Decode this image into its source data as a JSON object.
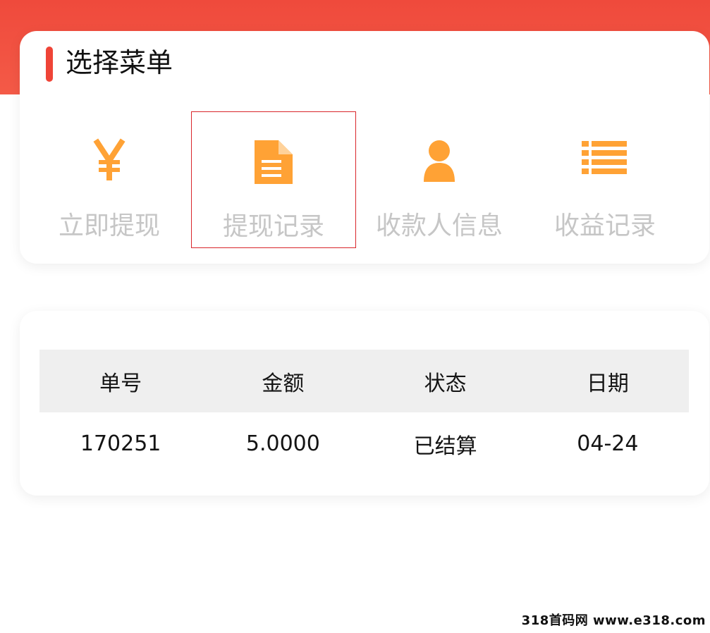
{
  "menu": {
    "title": "选择菜单",
    "items": [
      {
        "label": "立即提现",
        "icon": "yen-icon",
        "selected": false
      },
      {
        "label": "提现记录",
        "icon": "document-icon",
        "selected": true
      },
      {
        "label": "收款人信息",
        "icon": "person-icon",
        "selected": false
      },
      {
        "label": "收益记录",
        "icon": "list-icon",
        "selected": false
      }
    ]
  },
  "table": {
    "headers": [
      "单号",
      "金额",
      "状态",
      "日期"
    ],
    "rows": [
      [
        "170251",
        "5.0000",
        "已结算",
        "04-24"
      ]
    ]
  },
  "watermark": "318首码网 www.e318.com",
  "colors": {
    "accent": "#ef4437",
    "icon": "#ffa235",
    "label_muted": "#c6c6c6",
    "selected_border": "#d9262b"
  }
}
